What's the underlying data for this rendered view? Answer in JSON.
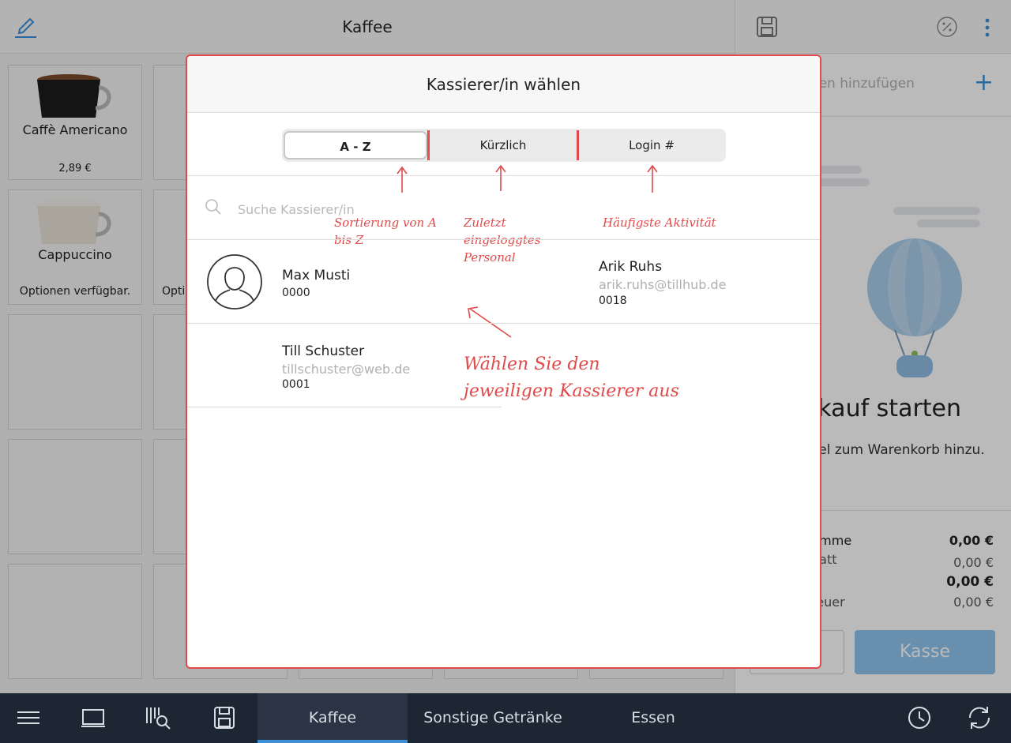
{
  "header": {
    "title": "Kaffee",
    "edit_icon": "pencil-icon"
  },
  "products": [
    {
      "name": "Caffè Americano",
      "price": "2,89 €"
    },
    {
      "name": "Cappuccino",
      "note": "Optionen verfügbar."
    },
    {
      "note": "Opti"
    }
  ],
  "cart": {
    "add_customer": "nden hinzufügen",
    "start_title": "rkauf starten",
    "start_subtitle": "kel zum Warenkorb hinzu.",
    "totals": [
      {
        "label": "umme",
        "value": "0,00 €"
      },
      {
        "label": "batt",
        "value": "0,00 €"
      },
      {
        "label": "",
        "value": "0,00 €"
      },
      {
        "label": "teuer",
        "value": "0,00 €"
      }
    ],
    "checkout_label": "Kasse"
  },
  "modal": {
    "title": "Kassierer/in wählen",
    "tabs": [
      "A - Z",
      "Kürzlich",
      "Login #"
    ],
    "selected_tab": "A - Z",
    "search_placeholder": "Suche Kassierer/in",
    "cashiers": [
      {
        "name": "Max Musti",
        "email": "",
        "code": "0000"
      },
      {
        "name": "Arik Ruhs",
        "email": "arik.ruhs@tillhub.de",
        "code": "0018"
      },
      {
        "name": "Till Schuster",
        "email": "tillschuster@web.de",
        "code": "0001"
      }
    ]
  },
  "annotations": {
    "sort": "Sortierung von A bis Z",
    "recent": "Zuletzt eingeloggtes Personal",
    "login": "Häufigste Aktivität",
    "choose": "Wählen Sie den jeweiligen Kassierer aus"
  },
  "bottom_nav": {
    "categories": [
      "Kaffee",
      "Sonstige Getränke",
      "Essen"
    ],
    "active_category": "Kaffee"
  },
  "colors": {
    "accent": "#3a8fd8",
    "annotation": "#e04a4a",
    "bottom_bar": "#1d2633"
  }
}
